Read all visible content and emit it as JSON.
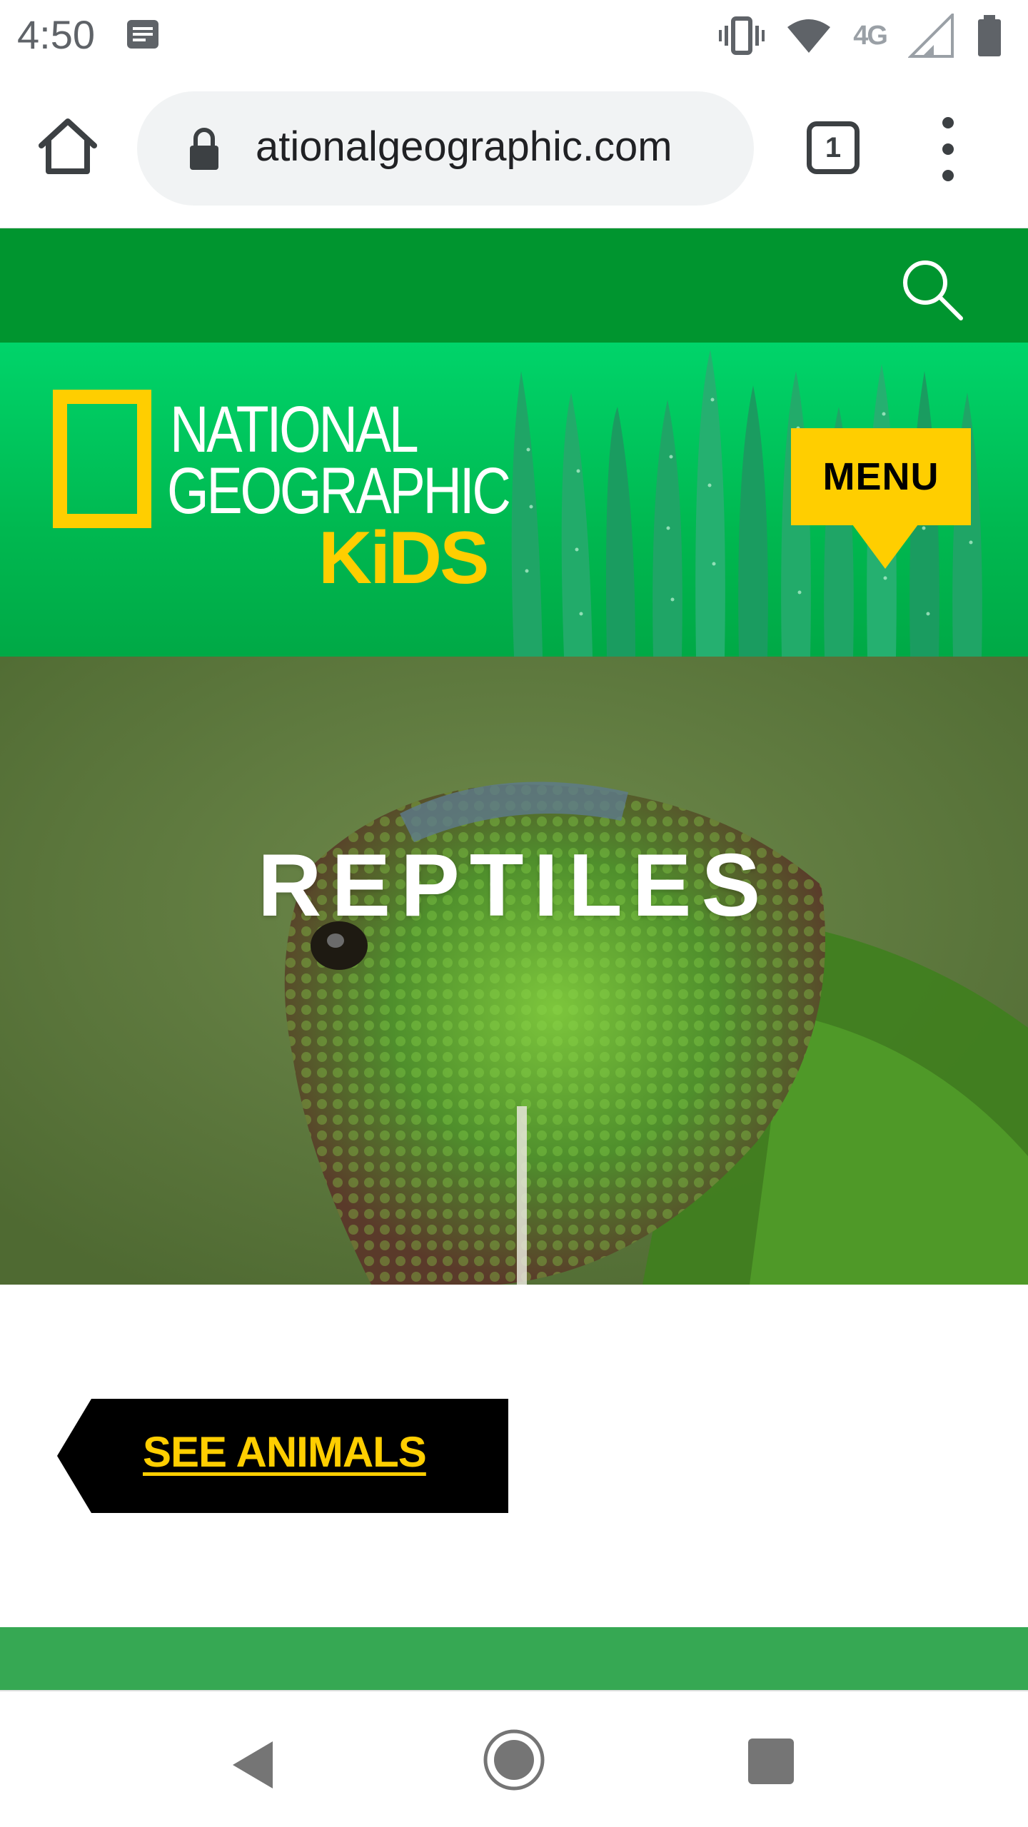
{
  "status_bar": {
    "time": "4:50",
    "network": "4G",
    "icons": [
      "notification-icon",
      "vibrate-icon",
      "wifi-icon",
      "signal-icon",
      "battery-icon"
    ]
  },
  "browser": {
    "url": "ationalgeographic.com",
    "tab_count": "1",
    "icons": [
      "home-icon",
      "lock-icon",
      "tabs-icon",
      "more-vert-icon"
    ]
  },
  "site": {
    "logo": {
      "line1": "NATIONAL",
      "line2": "GEOGRAPHIC",
      "line3": "KiDS"
    },
    "menu_label": "MENU",
    "hero_title": "REPTILES",
    "see_animals_label": "SEE ANIMALS"
  },
  "colors": {
    "nav_green": "#00952f",
    "header_green": "#00c85a",
    "brand_yellow": "#ffce00",
    "strip_green": "#36a853"
  }
}
